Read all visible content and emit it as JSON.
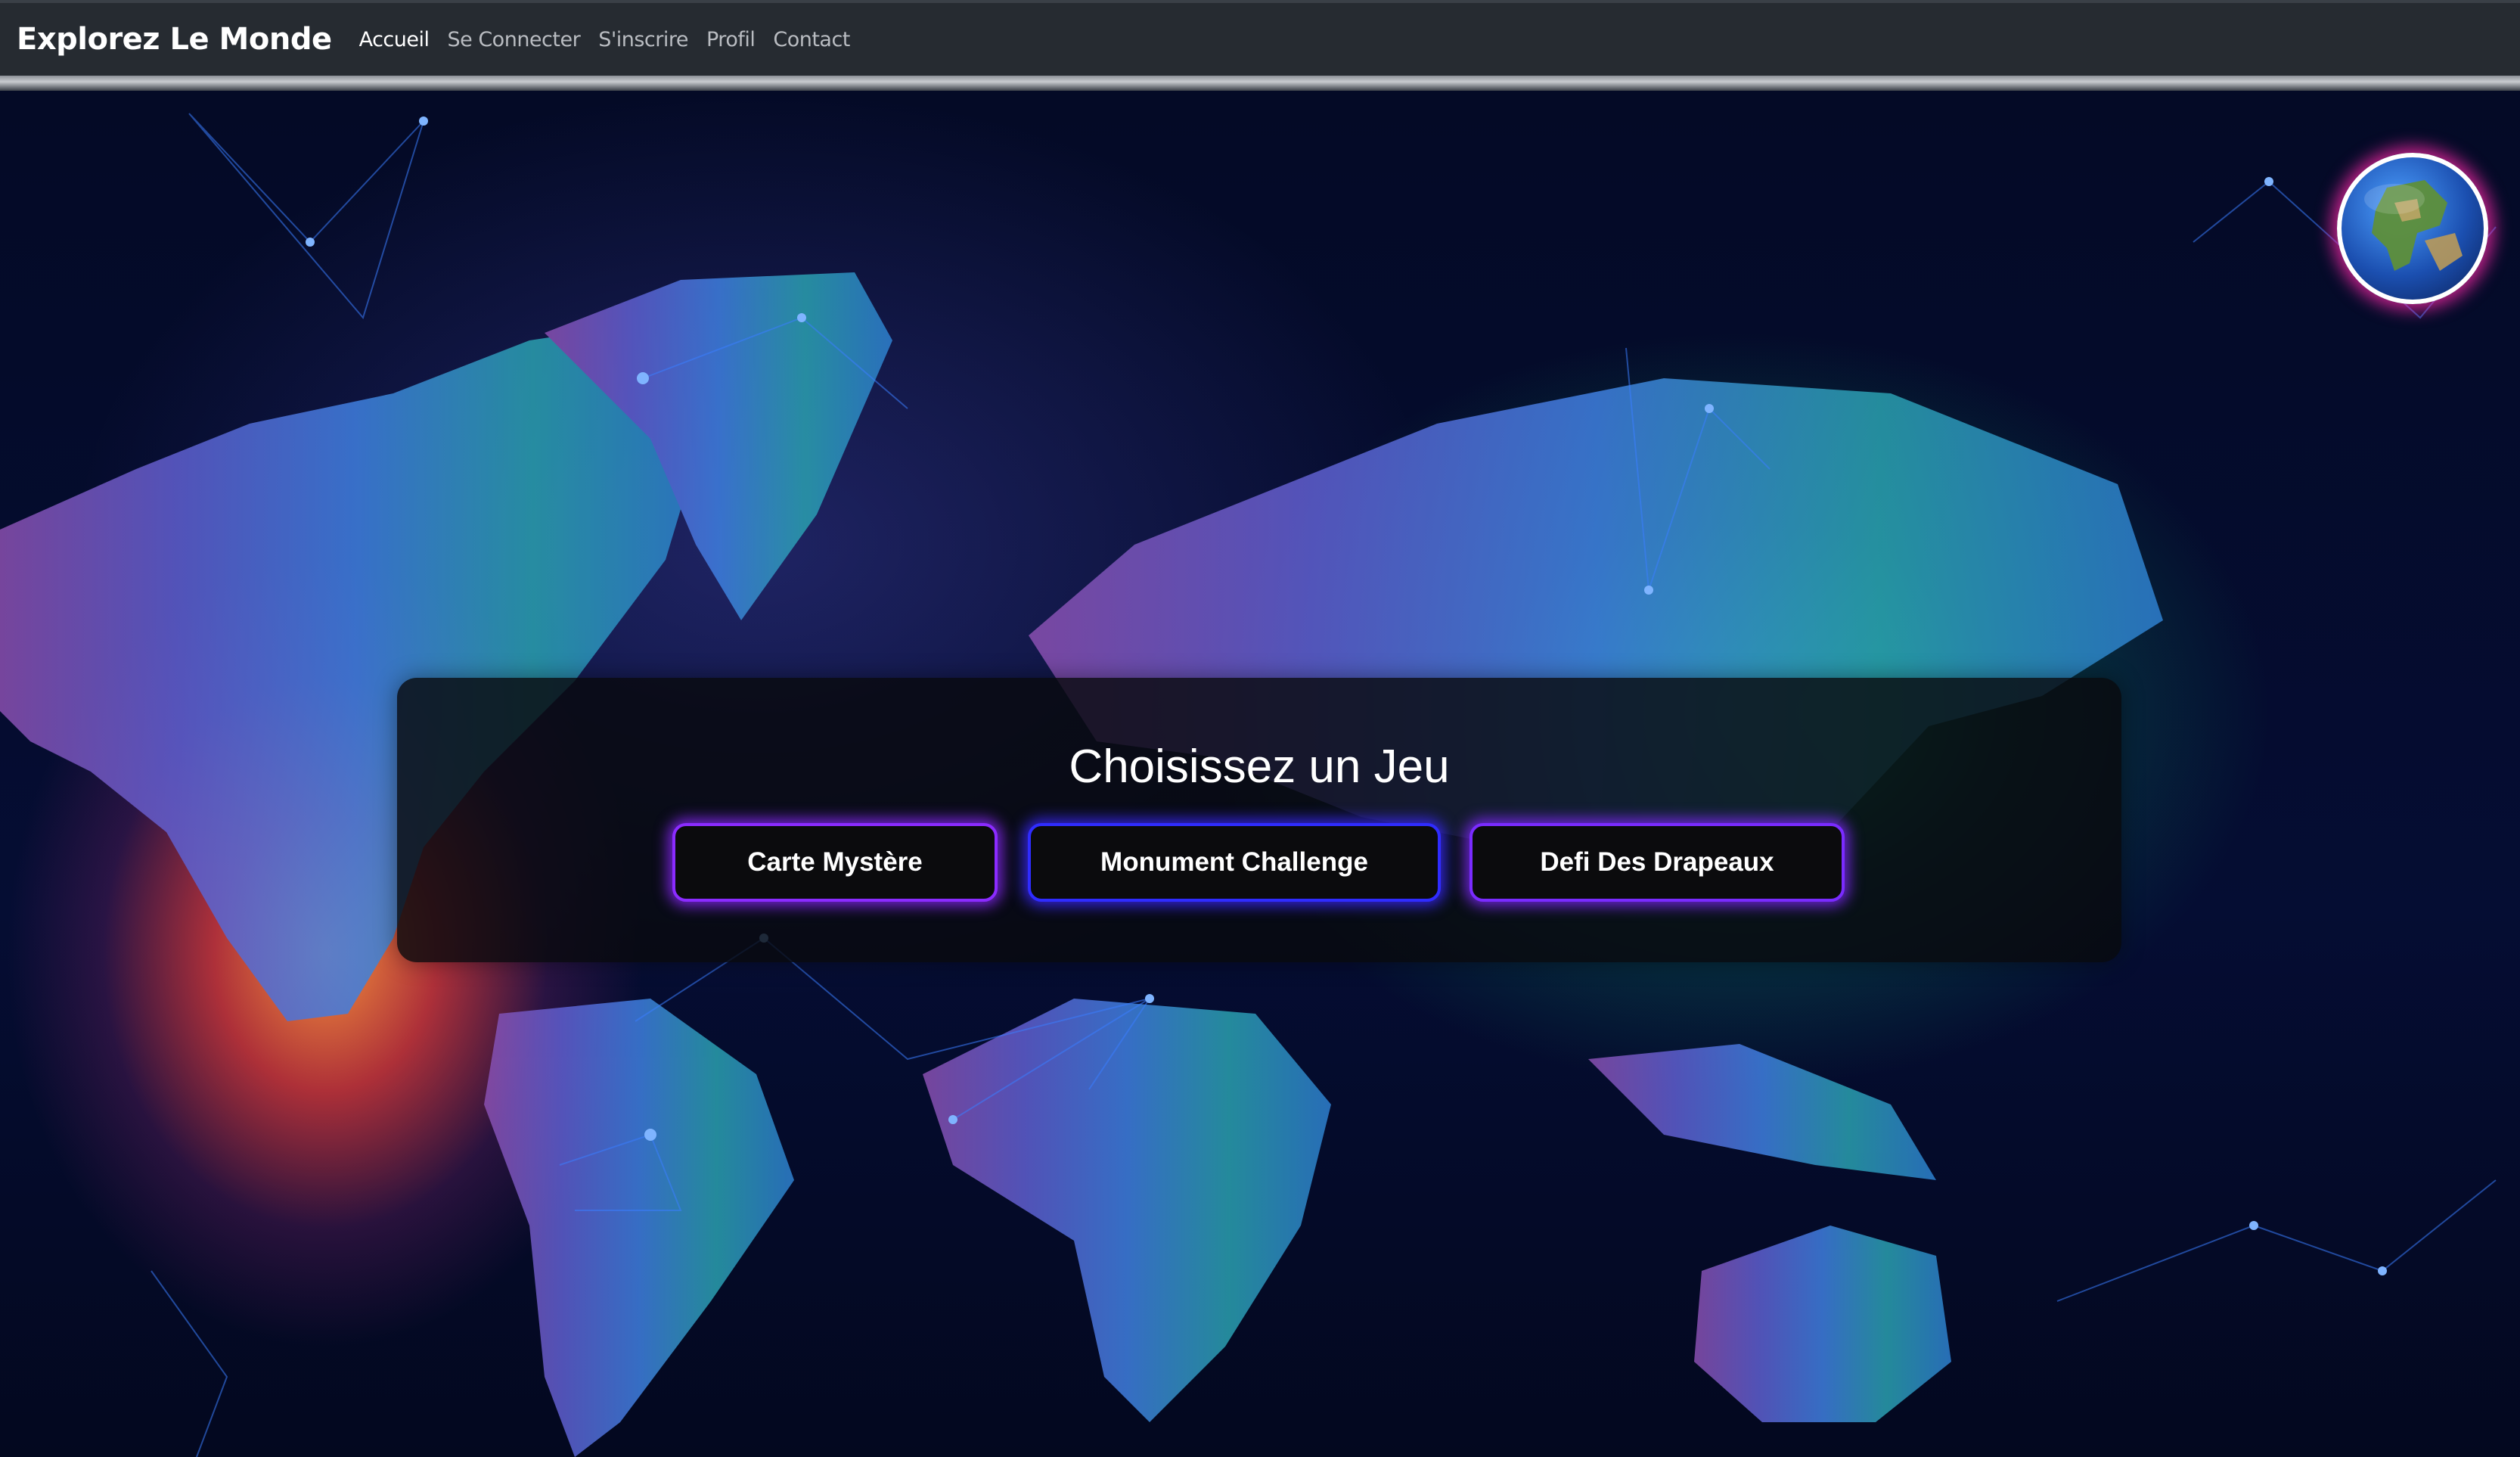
{
  "navbar": {
    "brand": "Explorez Le Monde",
    "links": [
      {
        "label": "Accueil",
        "active": true
      },
      {
        "label": "Se Connecter",
        "active": false
      },
      {
        "label": "S'inscrire",
        "active": false
      },
      {
        "label": "Profil",
        "active": false
      },
      {
        "label": "Contact",
        "active": false
      }
    ]
  },
  "hero": {
    "title": "Choisissez un Jeu",
    "games": [
      {
        "label": "Carte Mystère"
      },
      {
        "label": "Monument Challenge"
      },
      {
        "label": "Defi Des Drapeaux"
      }
    ]
  },
  "colors": {
    "navbar_bg": "#262b31",
    "background": "#040a26",
    "button_glow_purple": "#8b2bff",
    "button_glow_blue": "#2f2cff",
    "globe_glow": "#ff28aa"
  },
  "icons": {
    "globe": "earth-globe-icon"
  }
}
